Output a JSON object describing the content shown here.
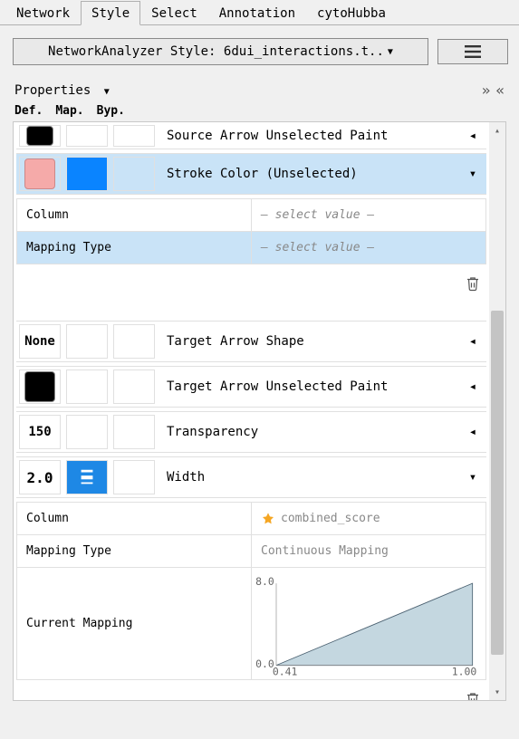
{
  "tabs": {
    "network": "Network",
    "style": "Style",
    "select": "Select",
    "annotation": "Annotation",
    "cytohubba": "cytoHubba"
  },
  "styleSelector": "NetworkAnalyzer Style: 6dui_interactions.t..",
  "panel": {
    "title": "Properties",
    "col_def": "Def.",
    "col_map": "Map.",
    "col_byp": "Byp."
  },
  "rows": {
    "r0": "Source Arrow Unselected Paint",
    "r1": "Stroke Color (Unselected)",
    "r2": "Target Arrow Shape",
    "r2def": "None",
    "r3": "Target Arrow Unselected Paint",
    "r4": "Transparency",
    "r4def": "150",
    "r5": "Width",
    "r5def": "2.0"
  },
  "mapping": {
    "column": "Column",
    "type": "Mapping Type",
    "selval": "— select value —",
    "combined": "combined_score",
    "continuous": "Continuous Mapping",
    "current": "Current Mapping"
  },
  "chart_data": {
    "type": "line",
    "x": [
      0.41,
      1.0
    ],
    "values": [
      0.0,
      8.0
    ],
    "xlabel": "",
    "ylabel": "",
    "title": "",
    "xlim": [
      0.41,
      1.0
    ],
    "ylim": [
      0.0,
      8.0
    ],
    "xticks": [
      "0.41",
      "1.00"
    ],
    "yticks": [
      "0.0",
      "8.0"
    ]
  }
}
